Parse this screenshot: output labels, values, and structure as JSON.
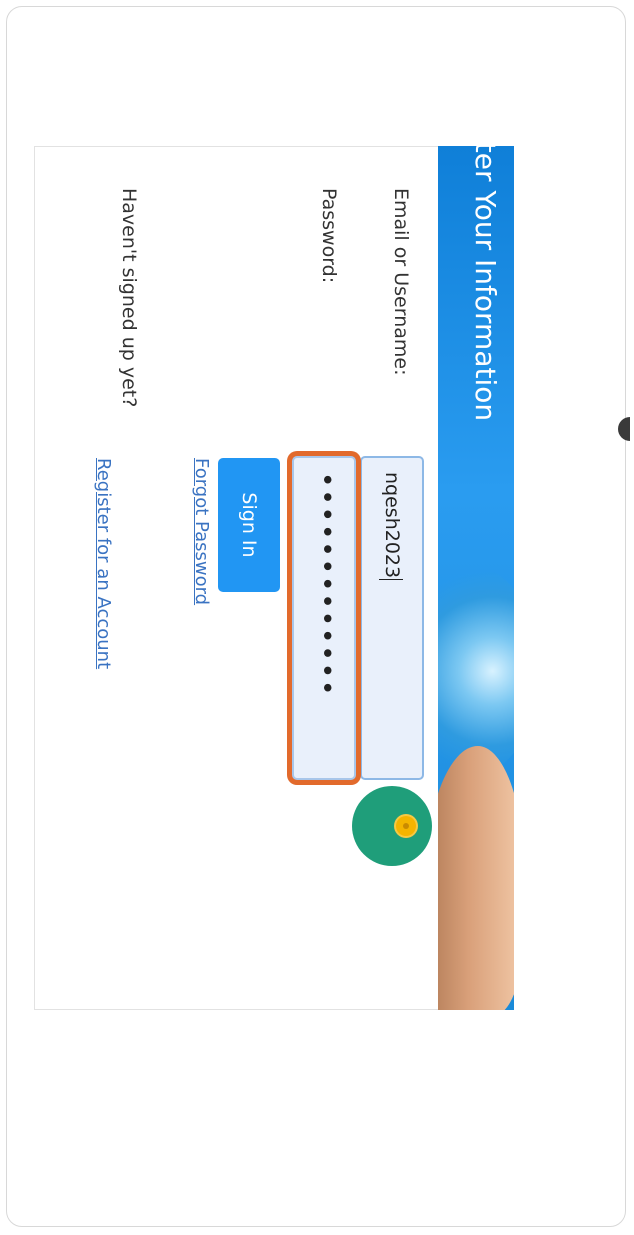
{
  "login": {
    "banner_title": "nter Your Information",
    "email_label": "Email or Username:",
    "email_value": "nqesh2023",
    "password_label": "Password:",
    "password_value": "•••••••••••••",
    "signin_label": "Sign In",
    "forgot_label": "Forgot Password",
    "signup_prompt": "Haven't signed up yet?",
    "register_label": "Register for an Account"
  },
  "colors": {
    "banner": "#1a8ad8",
    "button": "#2196f3",
    "link": "#3a73c2",
    "focus_ring": "#e26a2c",
    "fab": "#1f9e7a"
  },
  "icons": {
    "fab": "assistant-bubble-icon"
  }
}
